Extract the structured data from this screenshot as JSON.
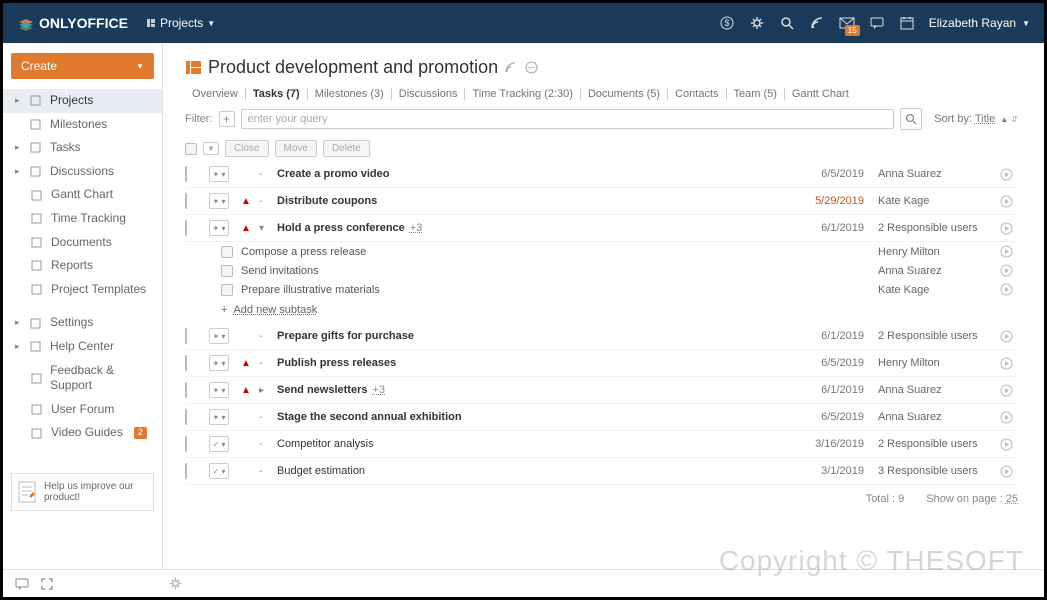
{
  "app_name": "ONLYOFFICE",
  "module_menu": "Projects",
  "user_name": "Elizabeth Rayan",
  "envelope_badge": "15",
  "sidebar": {
    "create_label": "Create",
    "nav1": [
      {
        "label": "Projects",
        "active": true,
        "caret": true
      },
      {
        "label": "Milestones"
      },
      {
        "label": "Tasks",
        "caret": true
      },
      {
        "label": "Discussions",
        "caret": true
      },
      {
        "label": "Gantt Chart",
        "sub": true
      },
      {
        "label": "Time Tracking",
        "sub": true
      },
      {
        "label": "Documents",
        "sub": true
      },
      {
        "label": "Reports",
        "sub": true
      },
      {
        "label": "Project Templates",
        "sub": true
      }
    ],
    "nav2": [
      {
        "label": "Settings",
        "caret": true
      },
      {
        "label": "Help Center",
        "caret": true
      },
      {
        "label": "Feedback & Support",
        "sub": true
      },
      {
        "label": "User Forum",
        "sub": true
      },
      {
        "label": "Video Guides",
        "sub": true,
        "badge": "2"
      }
    ],
    "improve_text": "Help us improve our product!"
  },
  "page": {
    "title": "Product development and promotion",
    "tabs": [
      "Overview",
      "Tasks (7)",
      "Milestones (3)",
      "Discussions",
      "Time Tracking (2:30)",
      "Documents (5)",
      "Contacts",
      "Team (5)",
      "Gantt Chart"
    ],
    "active_tab": 1,
    "filter_label": "Filter:",
    "filter_placeholder": "enter your query",
    "sort_label": "Sort by:",
    "sort_value": "Title",
    "actions": {
      "close": "Close",
      "move": "Move",
      "delete": "Delete"
    },
    "total_label": "Total :",
    "total_value": "9",
    "perpage_label": "Show on page :",
    "perpage_value": "25",
    "add_subtask": "Add new subtask"
  },
  "tasks": [
    {
      "title": "Create a promo video",
      "bold": true,
      "state": "open",
      "priority": "",
      "date": "6/5/2019",
      "user": "Anna Suarez"
    },
    {
      "title": "Distribute coupons",
      "bold": true,
      "state": "open",
      "priority": "high",
      "date": "5/29/2019",
      "overdue": true,
      "user": "Kate Kage"
    },
    {
      "title": "Hold a press conference",
      "bold": true,
      "state": "open",
      "priority": "high",
      "plus": "+3",
      "date": "6/1/2019",
      "user": "2 Responsible users",
      "subtasks": [
        {
          "label": "Compose a press release",
          "user": "Henry Milton"
        },
        {
          "label": "Send invitations",
          "user": "Anna Suarez"
        },
        {
          "label": "Prepare illustrative materials",
          "user": "Kate Kage"
        }
      ]
    },
    {
      "title": "Prepare gifts for purchase",
      "bold": true,
      "state": "open",
      "priority": "",
      "date": "6/1/2019",
      "user": "2 Responsible users"
    },
    {
      "title": "Publish press releases",
      "bold": true,
      "state": "open",
      "priority": "high",
      "date": "6/5/2019",
      "user": "Henry Milton"
    },
    {
      "title": "Send newsletters",
      "bold": true,
      "state": "open",
      "priority": "high",
      "plus": "+3",
      "date": "6/1/2019",
      "user": "Anna Suarez"
    },
    {
      "title": "Stage the second annual exhibition",
      "bold": true,
      "state": "open",
      "priority": "",
      "date": "6/5/2019",
      "user": "Anna Suarez"
    },
    {
      "title": "Competitor analysis",
      "bold": false,
      "state": "done",
      "priority": "",
      "date": "3/16/2019",
      "user": "2 Responsible users"
    },
    {
      "title": "Budget estimation",
      "bold": false,
      "state": "done",
      "priority": "",
      "date": "3/1/2019",
      "user": "3 Responsible users"
    }
  ],
  "watermark": "Copyright © THESOFT"
}
